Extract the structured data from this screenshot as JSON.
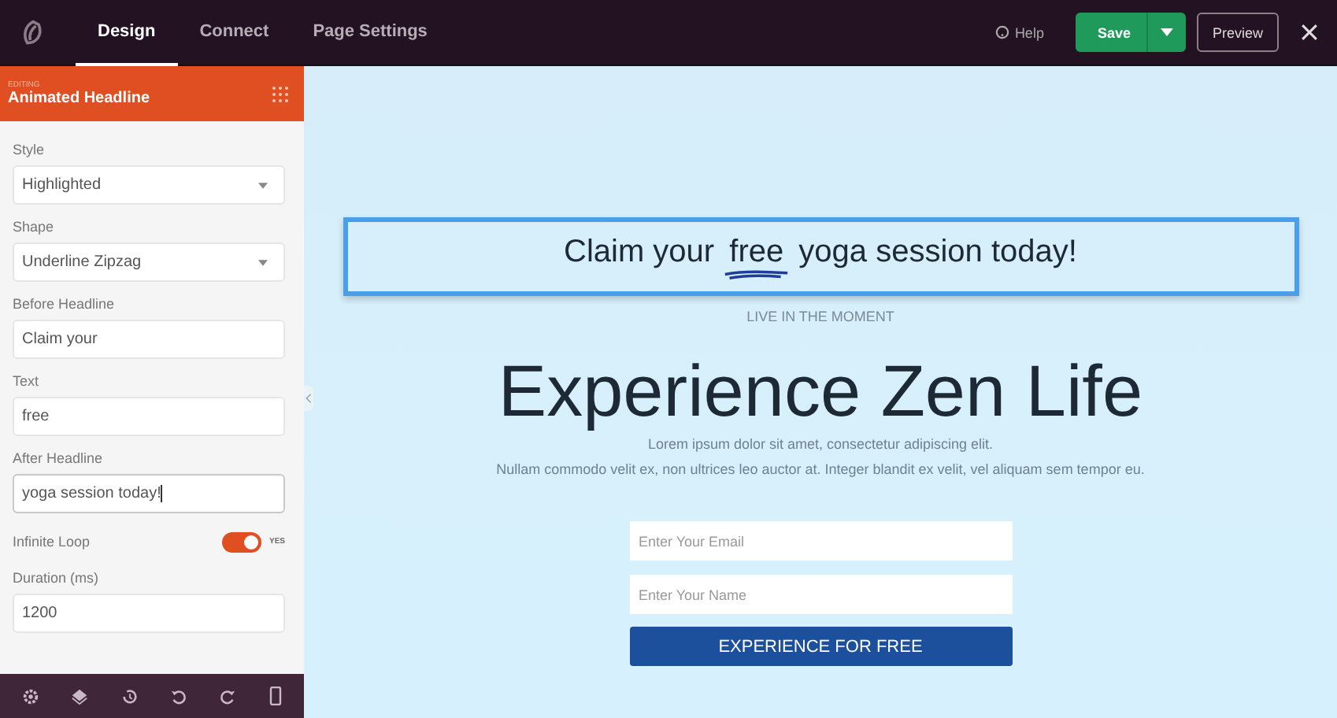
{
  "topbar": {
    "tabs": [
      {
        "label": "Design",
        "selected": true
      },
      {
        "label": "Connect",
        "selected": false
      },
      {
        "label": "Page Settings",
        "selected": false
      }
    ],
    "help": "Help",
    "save": "Save",
    "preview": "Preview"
  },
  "sidebar": {
    "editing_label": "EDITING",
    "title": "Animated Headline",
    "fields": [
      {
        "kind": "select",
        "label": "Style",
        "value": "Highlighted"
      },
      {
        "kind": "select",
        "label": "Shape",
        "value": "Underline Zipzag"
      },
      {
        "kind": "input",
        "label": "Before Headline",
        "value": "Claim your"
      },
      {
        "kind": "input",
        "label": "Text",
        "value": "free"
      },
      {
        "kind": "input",
        "label": "After Headline",
        "value": "yoga session today!",
        "focused": true
      },
      {
        "kind": "toggle",
        "label": "Infinite Loop",
        "on": true,
        "state_text": "YES"
      },
      {
        "kind": "input",
        "label": "Duration (ms)",
        "value": "1200"
      }
    ]
  },
  "canvas": {
    "headline": {
      "before": "Claim your",
      "highlight": "free",
      "after": "yoga session today!",
      "selected": true
    },
    "kicker": "LIVE IN THE MOMENT",
    "title": "Experience Zen Life",
    "body": [
      "Lorem ipsum dolor sit amet, consectetur adipiscing elit.",
      "Nullam commodo velit ex, non ultrices leo auctor at. Integer blandit ex velit, vel aliquam sem tempor eu."
    ],
    "email": {
      "placeholder": "Enter Your Email"
    },
    "name": {
      "placeholder": "Enter Your Name"
    },
    "button": "EXPERIENCE FOR FREE"
  }
}
